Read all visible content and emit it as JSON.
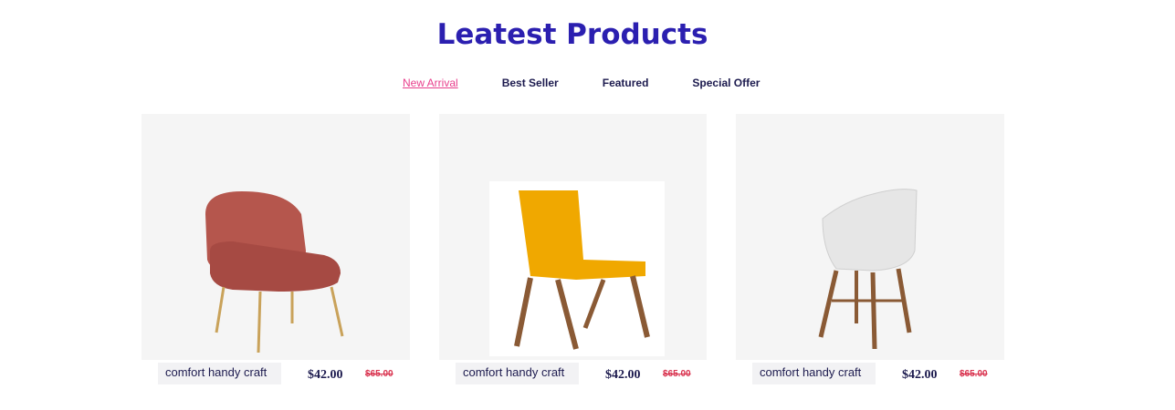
{
  "header": {
    "title": "Leatest Products"
  },
  "tabs": [
    {
      "label": "New Arrival",
      "active": true
    },
    {
      "label": "Best Seller"
    },
    {
      "label": "Featured"
    },
    {
      "label": "Special Offer"
    }
  ],
  "products": [
    {
      "name": "comfort handy craft",
      "price": "$42.00",
      "old_price": "$65.00",
      "image": "pink velvet armchair"
    },
    {
      "name": "comfort handy craft",
      "price": "$42.00",
      "old_price": "$65.00",
      "image": "yellow lounge chair"
    },
    {
      "name": "comfort handy craft",
      "price": "$42.00",
      "old_price": "$65.00",
      "image": "white shell chair"
    }
  ],
  "colors": {
    "title": "#2b1fb0",
    "active_tab": "#e83e8c",
    "old_price": "#d9334f"
  }
}
